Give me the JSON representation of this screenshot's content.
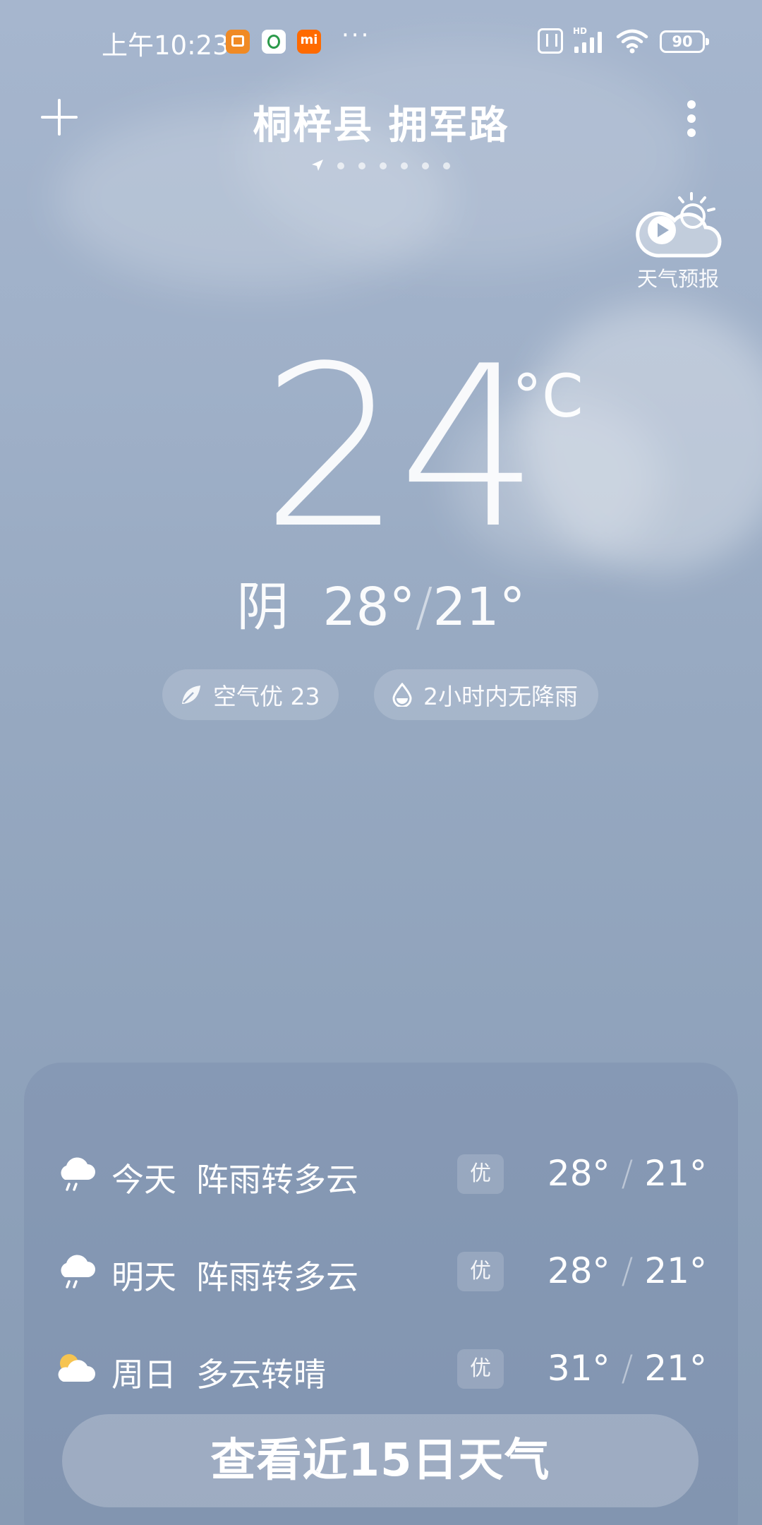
{
  "status_bar": {
    "time": "上午10:23",
    "more": "···",
    "battery": "90",
    "network_label": "HD"
  },
  "header": {
    "location": "桐梓县 拥军路",
    "page_count": 6
  },
  "forecast_video": {
    "label": "天气预报"
  },
  "current": {
    "temperature": "24",
    "unit": "°C",
    "condition": "阴",
    "high": "28°",
    "low": "21°",
    "separator": "/"
  },
  "chips": {
    "air_quality": "空气优 23",
    "precipitation": "2小时内无降雨"
  },
  "forecast": {
    "days": [
      {
        "name": "今天",
        "condition": "阵雨转多云",
        "aqi": "优",
        "high": "28°",
        "low": "21°",
        "icon": "rain-cloud-icon"
      },
      {
        "name": "明天",
        "condition": "阵雨转多云",
        "aqi": "优",
        "high": "28°",
        "low": "21°",
        "icon": "rain-cloud-icon"
      },
      {
        "name": "周日",
        "condition": "多云转晴",
        "aqi": "优",
        "high": "31°",
        "low": "21°",
        "icon": "partly-cloudy-icon"
      }
    ],
    "separator": "/",
    "button_label": "查看近15日天气"
  }
}
